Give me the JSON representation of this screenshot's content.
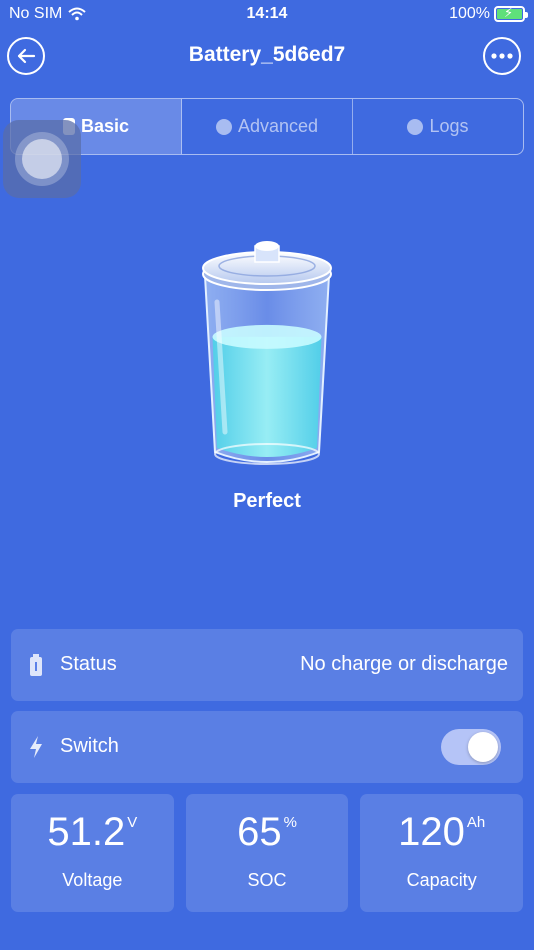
{
  "status_bar": {
    "carrier": "No SIM",
    "time": "14:14",
    "battery_percent": "100%"
  },
  "nav": {
    "title": "Battery_5d6ed7",
    "back_icon": "arrow-left-icon",
    "more_icon": "more-dots-icon"
  },
  "tabs": [
    {
      "label": "Basic",
      "icon": "battery-icon",
      "active": true
    },
    {
      "label": "Advanced",
      "icon": "robot-icon",
      "active": false
    },
    {
      "label": "Logs",
      "icon": "bell-icon",
      "active": false
    }
  ],
  "battery": {
    "health": "Perfect",
    "level": 0.65
  },
  "status_card": {
    "label": "Status",
    "value": "No charge or discharge",
    "icon": "battery-small-icon"
  },
  "switch_card": {
    "label": "Switch",
    "icon": "lightning-icon",
    "on": true
  },
  "metrics": [
    {
      "value": "51.2",
      "unit": "V",
      "label": "Voltage"
    },
    {
      "value": "65",
      "unit": "%",
      "label": "SOC"
    },
    {
      "value": "120",
      "unit": "Ah",
      "label": "Capacity"
    }
  ],
  "colors": {
    "background": "#3f6ae0",
    "liquid": "#7fe8f0",
    "charging_green": "#5fe07a"
  }
}
